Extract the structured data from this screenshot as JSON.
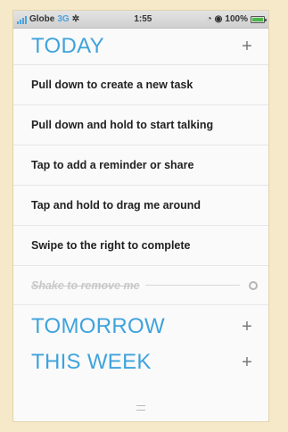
{
  "status_bar": {
    "carrier": "Globe",
    "carrier_num": "3G",
    "time": "1:55",
    "battery": "100%",
    "battery_level": 1.0
  },
  "sections": [
    {
      "title": "TODAY",
      "tasks": [
        "Pull down to create a new task",
        "Pull down and hold to start talking",
        "Tap to add a reminder or share",
        "Tap and hold to drag me around",
        "Swipe to the right to complete",
        "Shake to remove me"
      ]
    },
    {
      "title": "TOMORROW"
    },
    {
      "title": "THIS WEEK"
    }
  ],
  "icons": {
    "add": "plus-icon",
    "settings": "gear-icon",
    "handle": "drag-handle-icon"
  },
  "colors": {
    "accent": "#3fa3dc",
    "background": "#f6e9c9"
  }
}
